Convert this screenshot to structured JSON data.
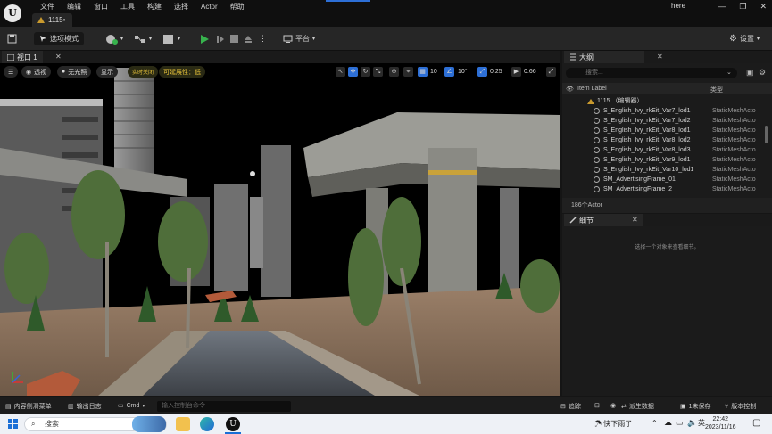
{
  "titlebar": {
    "menu": [
      "文件",
      "编辑",
      "窗口",
      "工具",
      "构建",
      "选择",
      "Actor",
      "帮助"
    ],
    "project_tab": "1115•",
    "here_label": "here",
    "window_controls": [
      "—",
      "❐",
      "✕"
    ]
  },
  "toolbar": {
    "mode_label": "选项模式",
    "platform_label": "平台",
    "settings_label": "设置"
  },
  "viewport": {
    "tab_label": "视口 1",
    "view_mode": "透视",
    "lighting": "无光照",
    "show": "显示",
    "realtime_off": "实时关闭",
    "scalability": "可延展性：低",
    "grid_snap": "10",
    "rot_snap": "10°",
    "scale_snap": "0.25",
    "camera_speed": "0.66"
  },
  "outliner": {
    "tab_label": "大纲",
    "search_placeholder": "搜索...",
    "col_item": "Item Label",
    "col_type": "类型",
    "root_label": "1115 （编辑器）",
    "rows": [
      {
        "name": "S_English_Ivy_rkEit_Var7_lod1",
        "type": "StaticMeshActo"
      },
      {
        "name": "S_English_Ivy_rkEit_Var7_lod2",
        "type": "StaticMeshActo"
      },
      {
        "name": "S_English_Ivy_rkEit_Var8_lod1",
        "type": "StaticMeshActo"
      },
      {
        "name": "S_English_Ivy_rkEit_Var8_lod2",
        "type": "StaticMeshActo"
      },
      {
        "name": "S_English_Ivy_rkEit_Var8_lod3",
        "type": "StaticMeshActo"
      },
      {
        "name": "S_English_Ivy_rkEit_Var9_lod1",
        "type": "StaticMeshActo"
      },
      {
        "name": "S_English_Ivy_rkEit_Var10_lod1",
        "type": "StaticMeshActo"
      },
      {
        "name": "SM_AdvertisingFrame_01",
        "type": "StaticMeshActo"
      },
      {
        "name": "SM_AdvertisingFrame_2",
        "type": "StaticMeshActo"
      }
    ],
    "count": "186个Actor"
  },
  "details": {
    "tab_label": "细节",
    "empty_text": "选择一个对象来查看细节。"
  },
  "statusbar": {
    "content_drawer": "内容侧滑菜单",
    "output_log": "输出日志",
    "cmd": "Cmd",
    "cmd_placeholder": "输入控制台命令",
    "trace": "追踪",
    "derived_data": "派生数据",
    "unsaved": "1未保存",
    "source_control": "版本控制"
  },
  "taskbar": {
    "search_label": "搜索",
    "weather": "快下雨了",
    "ime": "英",
    "time": "22:42",
    "date": "2023/11/16"
  },
  "colors": {
    "play_green": "#37b24d",
    "accent_blue": "#2d6fd6",
    "scalability_yellow": "#e8c33a"
  }
}
